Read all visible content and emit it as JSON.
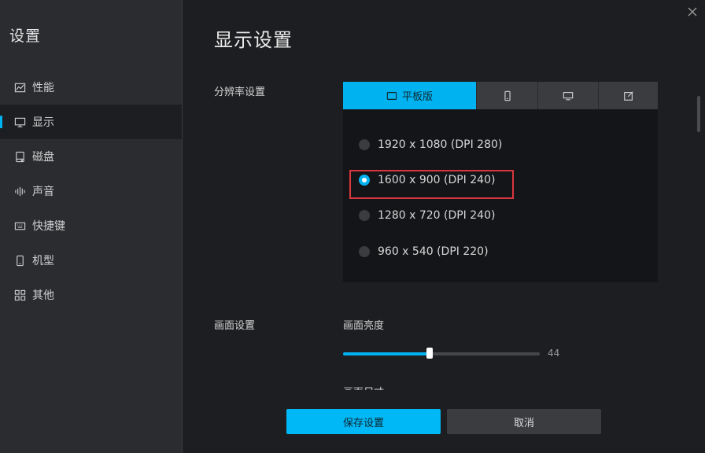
{
  "sidebar": {
    "title": "设置",
    "items": [
      {
        "label": "性能",
        "icon": "chart-line-icon",
        "active": false
      },
      {
        "label": "显示",
        "icon": "monitor-icon",
        "active": true
      },
      {
        "label": "磁盘",
        "icon": "disk-icon",
        "active": false
      },
      {
        "label": "声音",
        "icon": "sound-wave-icon",
        "active": false
      },
      {
        "label": "快捷键",
        "icon": "keyboard-icon",
        "active": false
      },
      {
        "label": "机型",
        "icon": "phone-icon",
        "active": false
      },
      {
        "label": "其他",
        "icon": "grid-icon",
        "active": false
      }
    ]
  },
  "main": {
    "title": "显示设置",
    "resolution": {
      "label": "分辨率设置",
      "tabs": [
        {
          "label": "平板版",
          "icon": "tablet-icon",
          "active": true
        },
        {
          "label": "",
          "icon": "phone-icon",
          "active": false
        },
        {
          "label": "",
          "icon": "monitor-icon",
          "active": false
        },
        {
          "label": "",
          "icon": "edit-icon",
          "active": false
        }
      ],
      "options": [
        {
          "label": "1920 x 1080 (DPI 280)",
          "checked": false
        },
        {
          "label": "1600 x 900 (DPI 240)",
          "checked": true
        },
        {
          "label": "1280 x 720 (DPI 240)",
          "checked": false
        },
        {
          "label": "960 x 540 (DPI 220)",
          "checked": false
        }
      ]
    },
    "display": {
      "label": "画面设置",
      "brightness_label": "画面亮度",
      "brightness_value": "44",
      "brightness_fraction": 0.44,
      "next_label_cut": "画面尺寸"
    }
  },
  "footer": {
    "save_label": "保存设置",
    "cancel_label": "取消"
  },
  "colors": {
    "accent": "#00b3f0",
    "highlight": "#d9363e"
  }
}
